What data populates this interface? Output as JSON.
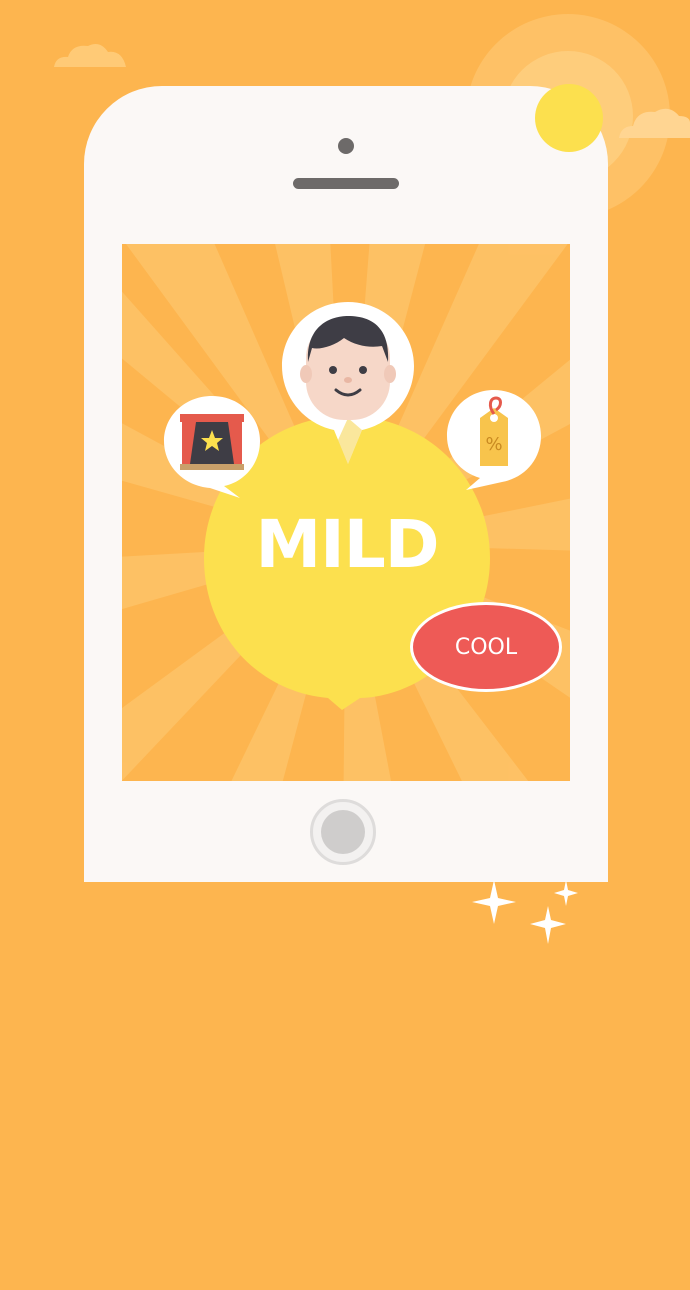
{
  "screen": {
    "headline": "MILD",
    "cool_button_label": "COOL"
  },
  "icons": {
    "sun": "sun-icon",
    "clouds": "cloud-icon",
    "profile": "person-avatar-icon",
    "theater": "theater-stage-star-icon",
    "discount": "discount-tag-icon",
    "sparkles": "sparkle-icon"
  },
  "colors": {
    "background": "#FDB54F",
    "bubble": "#FCE04E",
    "cool_button": "#EE5A56",
    "phone_body": "#FBF8F6"
  }
}
